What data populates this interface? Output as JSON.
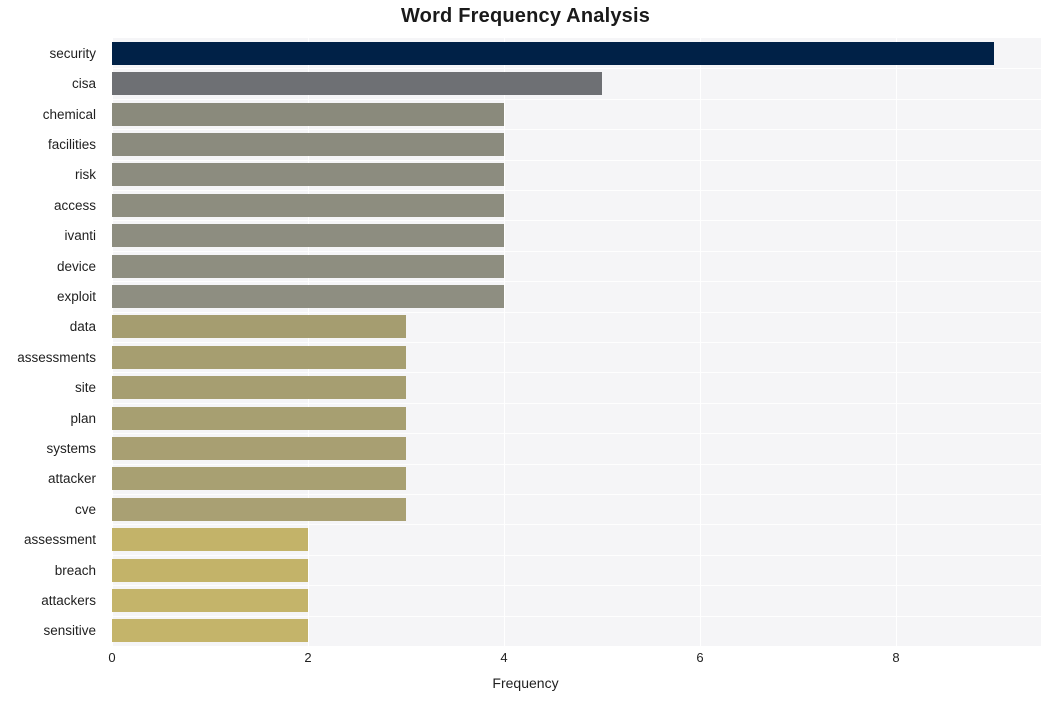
{
  "chart_data": {
    "type": "bar",
    "orientation": "horizontal",
    "title": "Word Frequency Analysis",
    "xlabel": "Frequency",
    "ylabel": "",
    "categories": [
      "security",
      "cisa",
      "chemical",
      "facilities",
      "risk",
      "access",
      "ivanti",
      "device",
      "exploit",
      "data",
      "assessments",
      "site",
      "plan",
      "systems",
      "attacker",
      "cve",
      "assessment",
      "breach",
      "attackers",
      "sensitive"
    ],
    "values": [
      9,
      5,
      4,
      4,
      4,
      4,
      4,
      4,
      4,
      3,
      3,
      3,
      3,
      3,
      3,
      3,
      2,
      2,
      2,
      2
    ],
    "xticks": [
      0,
      2,
      4,
      6,
      8
    ],
    "xtick_labels": [
      "0",
      "2",
      "4",
      "6",
      "8"
    ],
    "xlim": [
      0,
      9.48
    ],
    "grid": true,
    "grid_axis": "x",
    "legend": false,
    "bar_colors": [
      "#002147",
      "#6e7074",
      "#8a8a7c",
      "#8b8b7e",
      "#8c8c7f",
      "#8d8d7f",
      "#8d8d80",
      "#8e8e80",
      "#8e8e81",
      "#a59d70",
      "#a69e70",
      "#a69e71",
      "#a79f71",
      "#a89f72",
      "#a8a072",
      "#a9a073",
      "#c3b369",
      "#c3b369",
      "#c4b46a",
      "#c4b46a"
    ],
    "plot_background": "#f5f5f7",
    "figure_background": "#ffffff",
    "grid_color": "#ffffff"
  }
}
